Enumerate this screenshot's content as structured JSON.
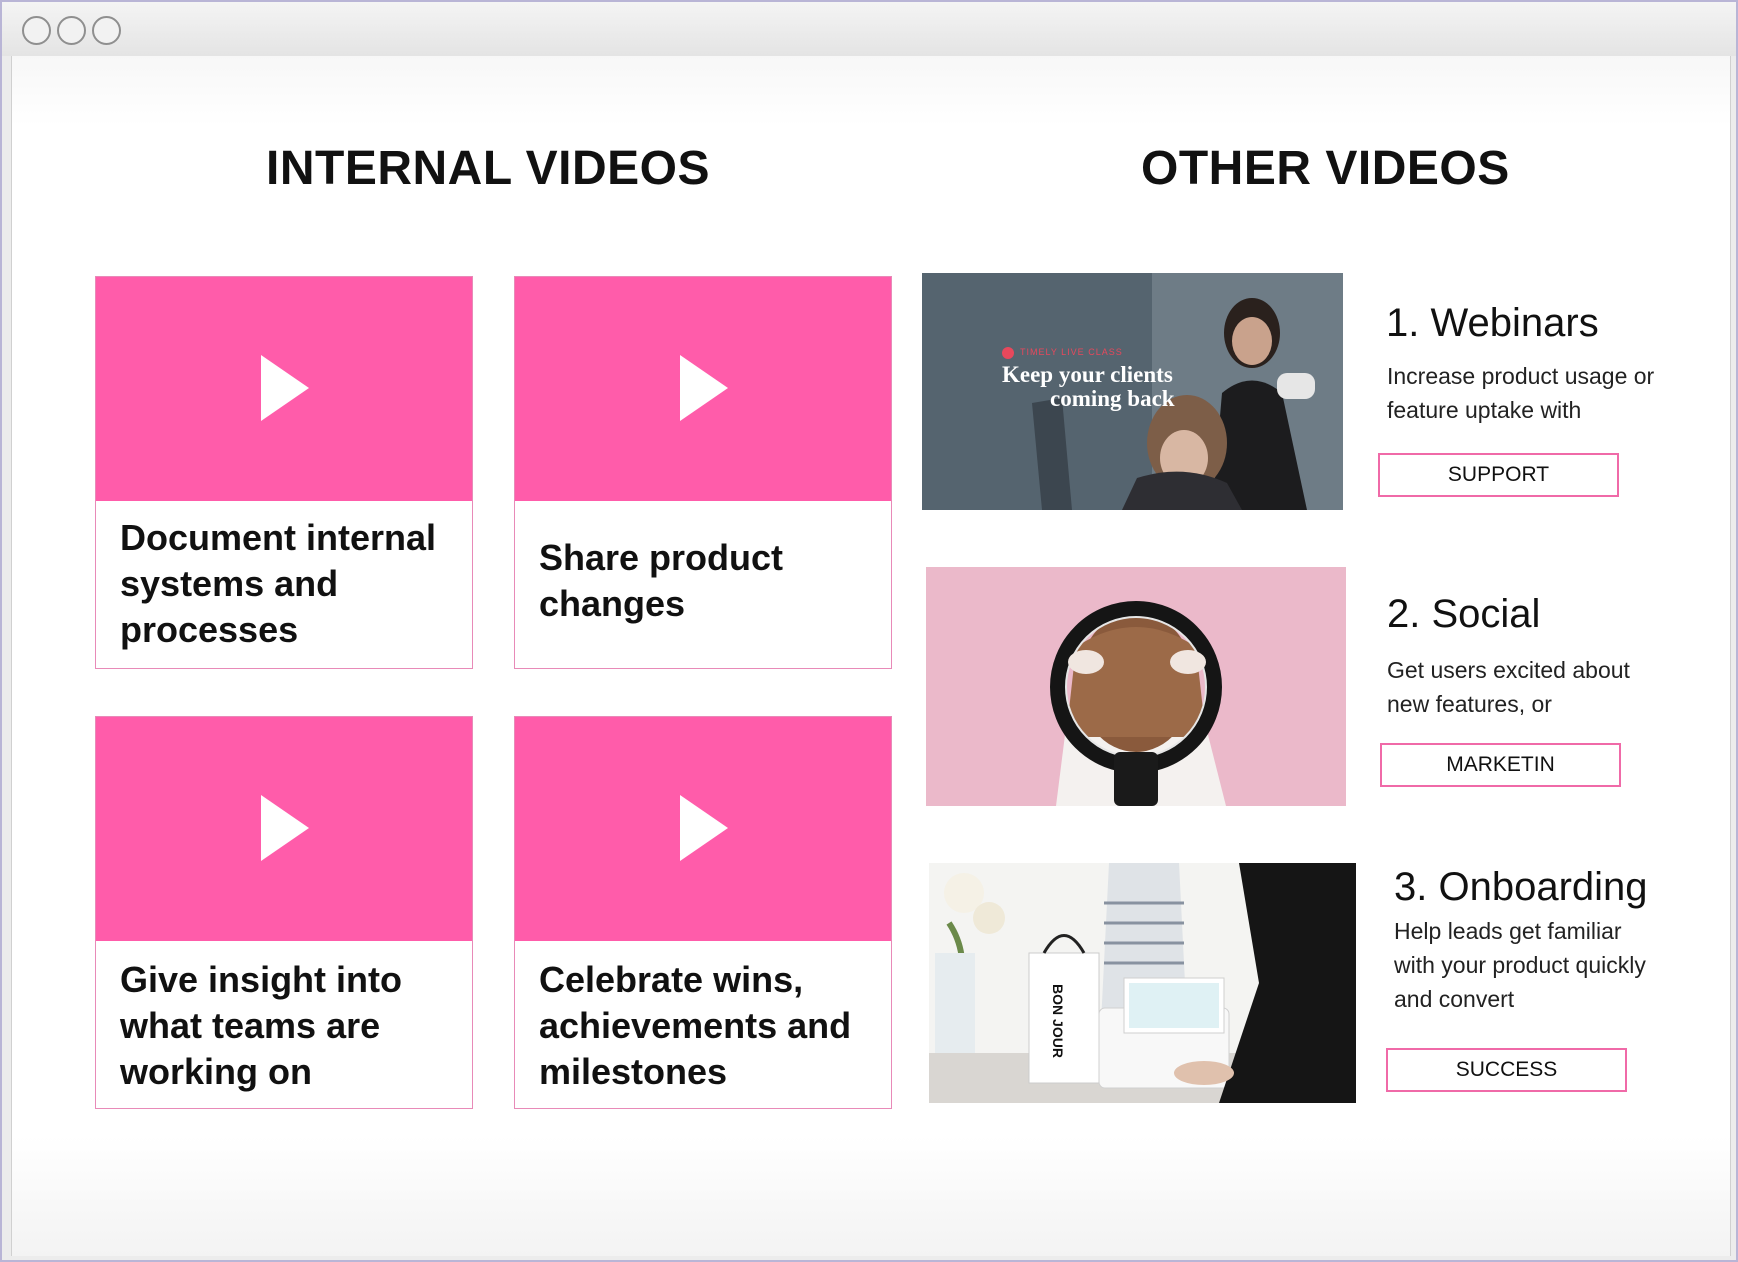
{
  "window": {
    "controls": [
      "close",
      "minimize",
      "maximize"
    ]
  },
  "internal": {
    "heading": "INTERNAL VIDEOS",
    "cards": [
      {
        "title": "Document internal systems and processes"
      },
      {
        "title": "Share product changes"
      },
      {
        "title": "Give insight into what teams are working on"
      },
      {
        "title": "Celebrate wins, achievements and milestones"
      }
    ]
  },
  "other": {
    "heading": "OTHER VIDEOS",
    "items": [
      {
        "title": "1. Webinars",
        "description": "Increase product usage or feature uptake with",
        "button": "SUPPORT",
        "thumb_tag": "TIMELY LIVE CLASS",
        "thumb_caption_line1": "Keep your clients",
        "thumb_caption_line2": "coming back"
      },
      {
        "title": "2. Social",
        "description": "Get users excited about new features, or",
        "button": "MARKETIN"
      },
      {
        "title": "3. Onboarding",
        "description": "Help leads get familiar with your product quickly and convert",
        "button": "SUCCESS",
        "thumb_bag_text": "BON JOUR"
      }
    ]
  },
  "colors": {
    "accent": "#ff5caa",
    "button_border": "#f06aa8",
    "card_border": "#e88ab8"
  }
}
